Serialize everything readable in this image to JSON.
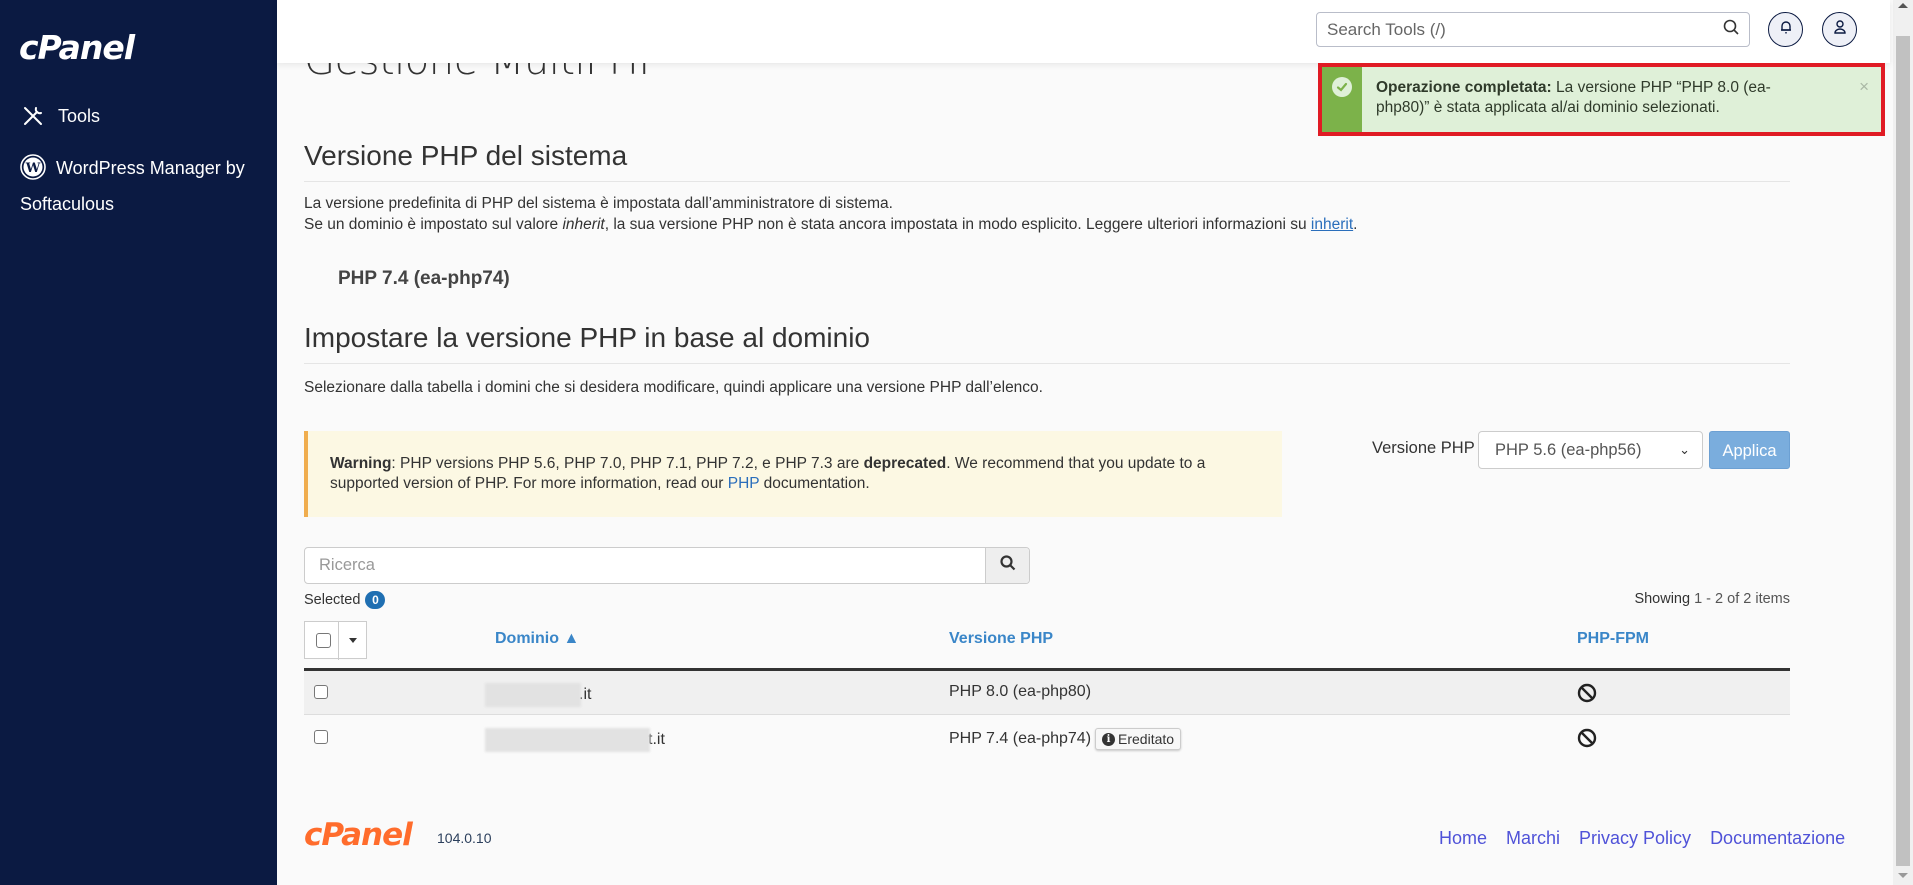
{
  "sidebar": {
    "logo": "cPanel",
    "items": [
      {
        "label": "Tools",
        "icon": "tools-icon"
      },
      {
        "label": "WordPress Manager by Softaculous",
        "icon": "wordpress-icon"
      }
    ]
  },
  "topbar": {
    "search_placeholder": "Search Tools (/)"
  },
  "toast": {
    "title": "Operazione completata:",
    "message": " La versione PHP “PHP 8.0 (ea-php80)” è stata applicata al/ai dominio selezionati.",
    "close": "×",
    "accent": "#7cb24a"
  },
  "page": {
    "title": "Gestione MultiPHP",
    "system": {
      "heading": "Versione PHP del sistema",
      "line1": "La versione predefinita di PHP del sistema è impostata dall’amministratore di sistema.",
      "line2_pre": "Se un dominio è impostato sul valore ",
      "line2_em": "inherit",
      "line2_mid": ", la sua versione PHP non è stata ancora impostata in modo esplicito. Leggere ulteriori informazioni su ",
      "line2_link": "inherit",
      "line2_post": ".",
      "version": "PHP 7.4 (ea-php74)"
    },
    "domain": {
      "heading": "Impostare la versione PHP in base al dominio",
      "description": "Selezionare dalla tabella i domini che si desidera modificare, quindi applicare una versione PHP dall’elenco."
    },
    "warning": {
      "label": "Warning",
      "text1": ": PHP versions PHP 5.6, PHP 7.0, PHP 7.1, PHP 7.2, e PHP 7.3 are ",
      "bold": "deprecated",
      "text2": ". We recommend that you update to a supported version of PHP. For more information, read our ",
      "link": "PHP",
      "text3": " documentation."
    },
    "version_selector": {
      "label": "Versione PHP",
      "selected": "PHP 5.6 (ea-php56)",
      "apply": "Applica"
    },
    "table": {
      "search_placeholder": "Ricerca",
      "selected_label": "Selected",
      "selected_count": "0",
      "showing_label": "Showing",
      "showing_range": "1 - 2 of 2 items",
      "columns": [
        "Dominio ▲",
        "Versione PHP",
        "PHP-FPM"
      ],
      "rows": [
        {
          "domain": ".it",
          "version": "PHP 8.0 (ea-php80)",
          "inherited": null,
          "fpm": "disabled"
        },
        {
          "domain": "t.it",
          "version": "PHP 7.4 (ea-php74)",
          "inherited": "Ereditato",
          "fpm": "disabled"
        }
      ]
    }
  },
  "footer": {
    "logo": "cPanel",
    "version": "104.0.10",
    "links": [
      "Home",
      "Marchi",
      "Privacy Policy",
      "Documentazione"
    ]
  }
}
